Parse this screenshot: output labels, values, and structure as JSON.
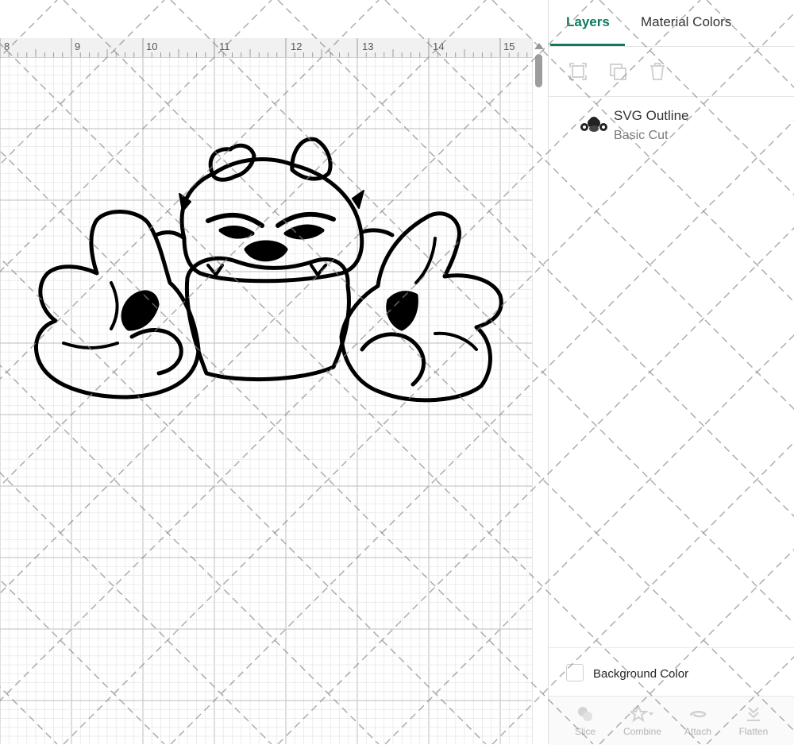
{
  "ruler": {
    "labels": [
      "8",
      "9",
      "10",
      "11",
      "12",
      "13",
      "14",
      "15"
    ]
  },
  "panel": {
    "tabs": [
      {
        "label": "Layers"
      },
      {
        "label": "Material Colors"
      }
    ],
    "layer_tools": [
      {
        "icon": "duplicate-icon"
      },
      {
        "icon": "copy-icon"
      },
      {
        "icon": "trash-icon"
      }
    ],
    "layer": {
      "name": "SVG Outline",
      "operation": "Basic Cut"
    },
    "background_color_label": "Background Color",
    "bottom_tools": [
      {
        "label": "Slice",
        "icon": "slice-icon"
      },
      {
        "label": "Combine",
        "icon": "combine-icon"
      },
      {
        "label": "Attach",
        "icon": "attach-icon"
      },
      {
        "label": "Flatten",
        "icon": "flatten-icon"
      }
    ]
  },
  "colors": {
    "accent": "#0d7a5f",
    "grid_major": "#c9c9c9",
    "grid_minor": "#e7e7e7"
  }
}
